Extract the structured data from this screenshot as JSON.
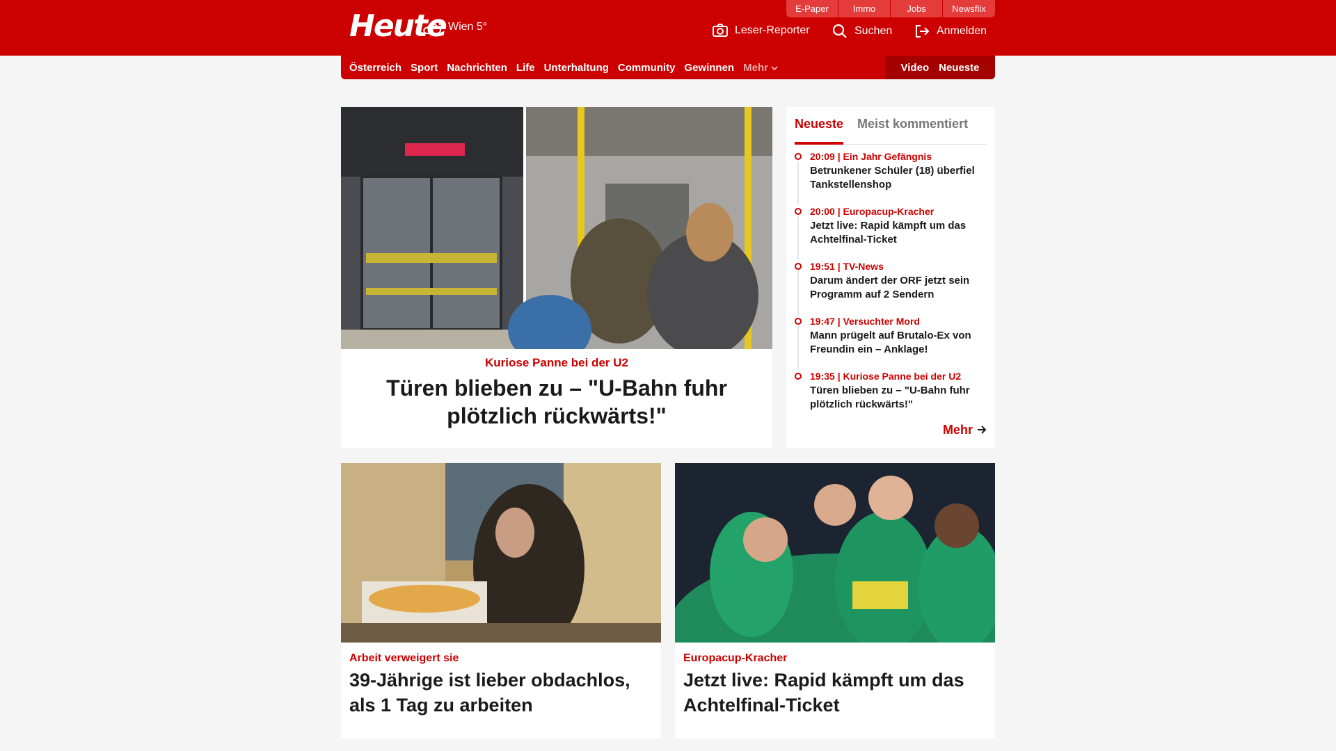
{
  "brand": {
    "logo_text": "Heute",
    "weather": "Wien 5°",
    "primary_color": "#cc0000"
  },
  "service_links": [
    "E-Paper",
    "Immo",
    "Jobs",
    "Newsflix"
  ],
  "header_actions": {
    "reporter_label": "Leser-Reporter",
    "search_label": "Suchen",
    "login_label": "Anmelden"
  },
  "nav": {
    "items": [
      "Österreich",
      "Sport",
      "Nachrichten",
      "Life",
      "Unterhaltung",
      "Community",
      "Gewinnen"
    ],
    "more_label": "Mehr",
    "video_label": "Video",
    "latest_label": "Neueste"
  },
  "hero": {
    "kicker": "Kuriose Panne bei der U2",
    "title": "Türen blieben zu – \"U-Bahn fuhr plötzlich rückwärts!\""
  },
  "sidebar": {
    "tabs": [
      "Neueste",
      "Meist kommentiert"
    ],
    "active_tab": "Neueste",
    "items": [
      {
        "meta": "20:09 | Ein Jahr Gefängnis",
        "title": "Betrunkener Schüler (18) überfiel Tankstellenshop"
      },
      {
        "meta": "20:00 | Europacup-Kracher",
        "title": "Jetzt live: Rapid kämpft um das Achtelfinal-Ticket"
      },
      {
        "meta": "19:51 | TV-News",
        "title": "Darum ändert der ORF jetzt sein Programm auf 2 Sendern"
      },
      {
        "meta": "19:47 | Versuchter Mord",
        "title": "Mann prügelt auf Brutalo-Ex von Freundin ein – Anklage!"
      },
      {
        "meta": "19:35 | Kuriose Panne bei der U2",
        "title": "Türen blieben zu – \"U-Bahn fuhr plötzlich rückwärts!\""
      }
    ],
    "more_label": "Mehr"
  },
  "cards": [
    {
      "kicker": "Arbeit verweigert sie",
      "title": "39-Jährige ist lieber obdachlos, als 1 Tag zu arbeiten"
    },
    {
      "kicker": "Europacup-Kracher",
      "title": "Jetzt live: Rapid kämpft um das Achtelfinal-Ticket"
    }
  ],
  "icons": {
    "weather": "cloud-sun-icon",
    "reporter": "camera-icon",
    "search": "search-icon",
    "login": "login-icon",
    "more_chevron": "chevron-down-icon",
    "more_arrow": "arrow-right-icon"
  }
}
